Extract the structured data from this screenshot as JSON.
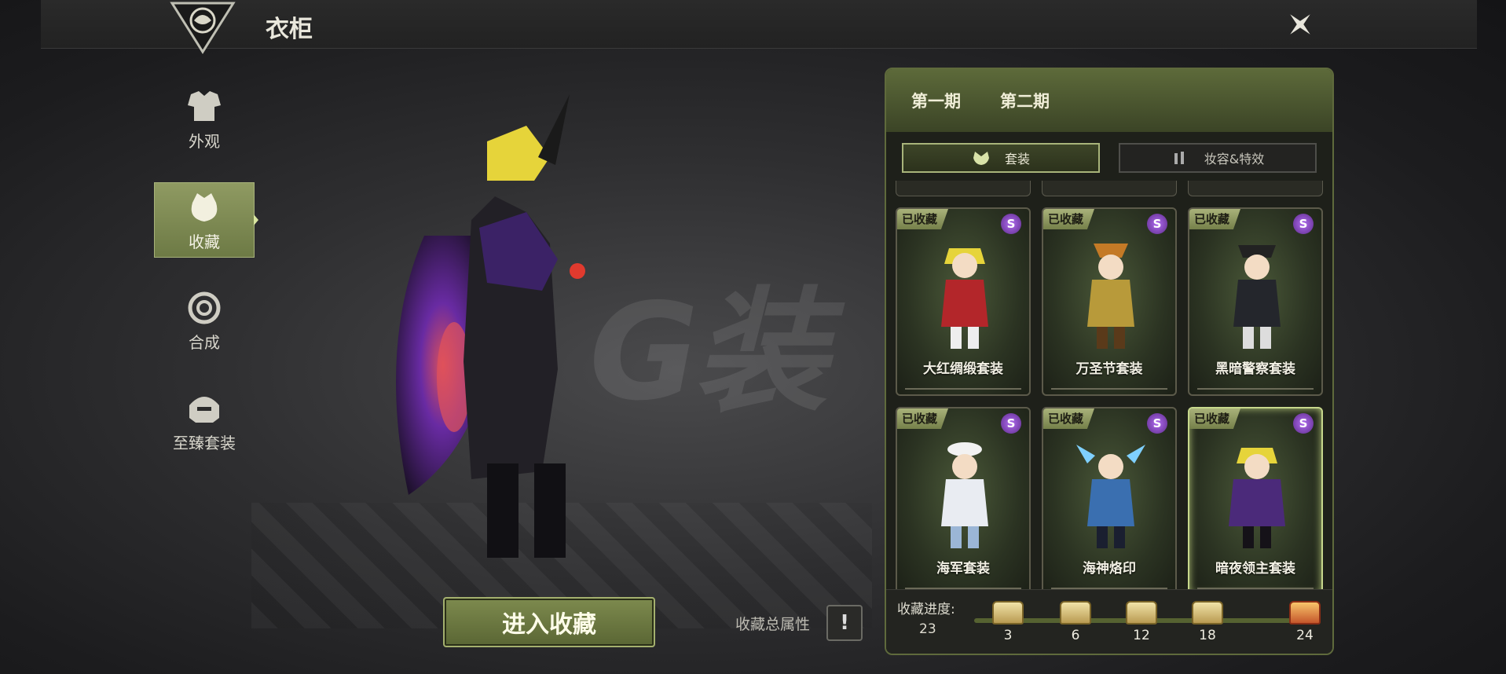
{
  "header": {
    "title": "衣柜",
    "emblem_icon": "dragon-emblem-icon",
    "close_icon": "close-x-icon"
  },
  "nav": {
    "items": [
      {
        "label": "外观",
        "icon": "armor-icon",
        "active": false
      },
      {
        "label": "收藏",
        "icon": "collection-bag-icon",
        "active": true
      },
      {
        "label": "合成",
        "icon": "swirl-icon",
        "active": false
      },
      {
        "label": "至臻套装",
        "icon": "helmet-icon",
        "active": false
      }
    ]
  },
  "stage": {
    "enter_button": "进入收藏",
    "attr_label": "收藏总属性",
    "attr_icon": "!"
  },
  "panel": {
    "periods": [
      "第一期",
      "第二期"
    ],
    "subtabs": [
      {
        "label": "套装",
        "icon": "outfit-icon",
        "active": true
      },
      {
        "label": "妆容&特效",
        "icon": "makeup-icon",
        "active": false
      }
    ],
    "cards": [
      {
        "badge": "已收藏",
        "rarity": "S",
        "name": "大红绸缎套装",
        "selected": false
      },
      {
        "badge": "已收藏",
        "rarity": "S",
        "name": "万圣节套装",
        "selected": false
      },
      {
        "badge": "已收藏",
        "rarity": "S",
        "name": "黑暗警察套装",
        "selected": false
      },
      {
        "badge": "已收藏",
        "rarity": "S",
        "name": "海军套装",
        "selected": false
      },
      {
        "badge": "已收藏",
        "rarity": "S",
        "name": "海神烙印",
        "selected": false
      },
      {
        "badge": "已收藏",
        "rarity": "S",
        "name": "暗夜领主套装",
        "selected": true
      }
    ],
    "progress": {
      "label": "收藏进度:",
      "value": "23",
      "milestones": [
        "3",
        "6",
        "12",
        "18",
        "24"
      ]
    }
  },
  "colors": {
    "accent": "#7d8a4e",
    "panel_border": "#5f6a3c",
    "rarity": "#8a44c8"
  }
}
